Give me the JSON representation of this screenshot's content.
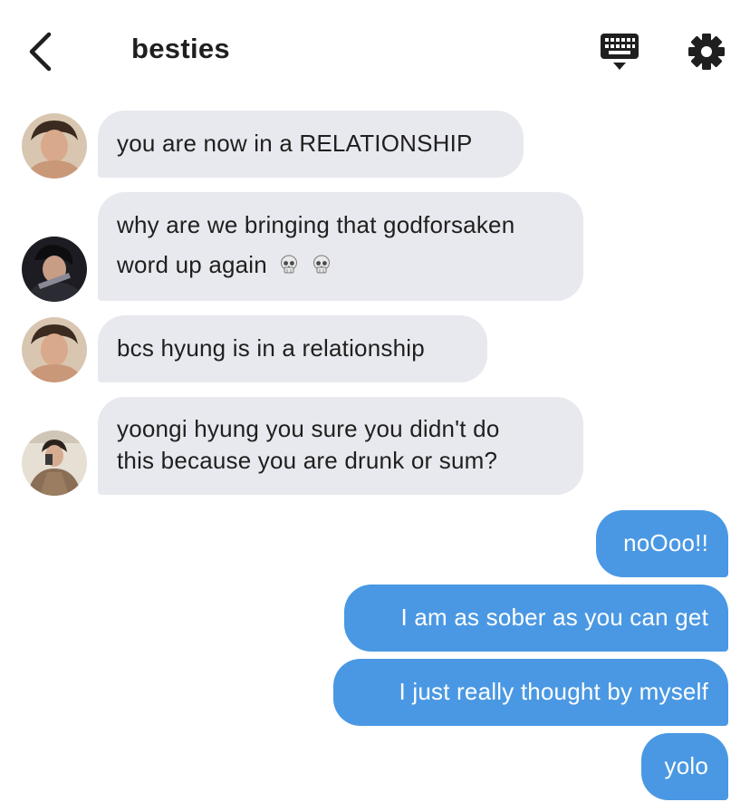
{
  "header": {
    "title": "besties",
    "back_icon": "chevron-left-icon",
    "keyboard_icon": "keyboard-icon",
    "settings_icon": "gear-icon"
  },
  "colors": {
    "incoming_bubble": "#e8e9ee",
    "outgoing_bubble": "#4a98e3",
    "text": "#1f1f1f"
  },
  "messages": [
    {
      "direction": "incoming",
      "sender_avatar": "avatar-1",
      "lines": [
        "you are now in a RELATIONSHIP"
      ]
    },
    {
      "direction": "incoming",
      "sender_avatar": "avatar-2",
      "lines": [
        "why are we bringing that godforsaken",
        "word up again"
      ],
      "trailing_icons": [
        "skull-icon",
        "skull-icon"
      ]
    },
    {
      "direction": "incoming",
      "sender_avatar": "avatar-1",
      "lines": [
        "bcs hyung is in a relationship"
      ]
    },
    {
      "direction": "incoming",
      "sender_avatar": "avatar-3",
      "lines": [
        "yoongi hyung you sure you didn't do",
        "this because you are drunk or sum?"
      ]
    },
    {
      "direction": "outgoing",
      "lines": [
        "noOoo!!"
      ]
    },
    {
      "direction": "outgoing",
      "lines": [
        "I am as sober as you can get"
      ]
    },
    {
      "direction": "outgoing",
      "lines": [
        "I just really thought by myself"
      ]
    },
    {
      "direction": "outgoing",
      "lines": [
        "yolo"
      ]
    }
  ]
}
